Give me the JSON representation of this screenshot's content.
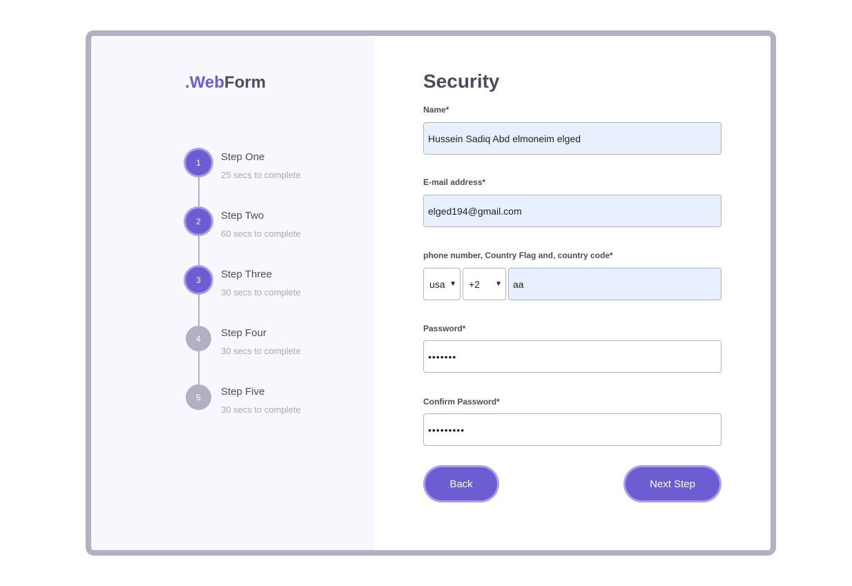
{
  "logo": {
    "accent": ".Web",
    "rest": "Form"
  },
  "steps": [
    {
      "number": "1",
      "title": "Step One",
      "sub": "25 secs to complete"
    },
    {
      "number": "2",
      "title": "Step Two",
      "sub": "60 secs to complete"
    },
    {
      "number": "3",
      "title": "Step Three",
      "sub": "30 secs to complete"
    },
    {
      "number": "4",
      "title": "Step Four",
      "sub": "30 secs to complete"
    },
    {
      "number": "5",
      "title": "Step Five",
      "sub": "30 secs to complete"
    }
  ],
  "form": {
    "heading": "Security",
    "name_label": "Name*",
    "name_value": "Hussein Sadiq Abd elmoneim elged",
    "email_label": "E-mail address*",
    "email_value": "elged194@gmail.com",
    "phone_label": "phone number, Country Flag and, country code*",
    "country_value": "usa",
    "code_value": "+2",
    "phone_value": "aa",
    "password_label": "Password*",
    "password_value": "•••••••",
    "confirm_label": "Confirm Password*",
    "confirm_value": "•••••••••",
    "back_label": "Back",
    "next_label": "Next Step"
  },
  "colors": {
    "accent": "#6c5dd3",
    "inactive": "#b3b0c4",
    "text": "#4b4c5e",
    "autofill": "#e8f0fe"
  }
}
